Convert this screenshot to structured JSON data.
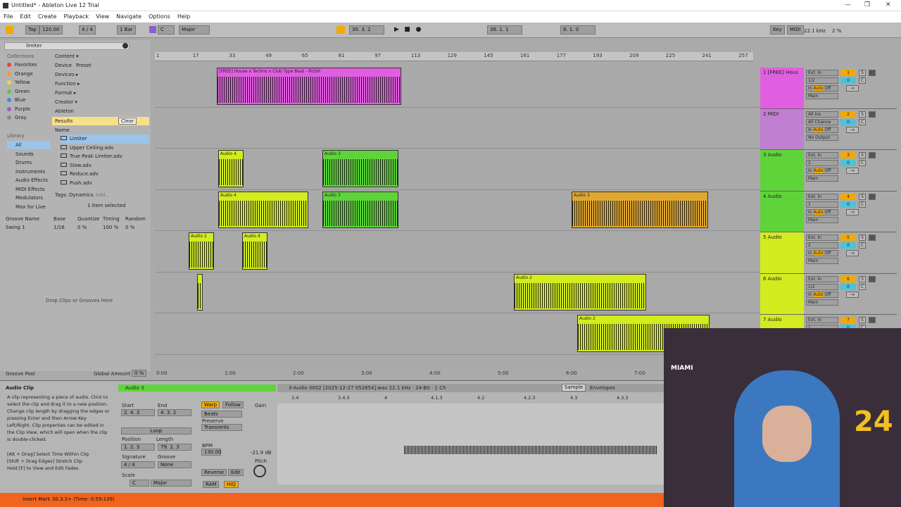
{
  "window": {
    "title": "Untitled* - Ableton Live 12 Trial",
    "min": "—",
    "max": "❐",
    "close": "✕"
  },
  "menu": [
    "File",
    "Edit",
    "Create",
    "Playback",
    "View",
    "Navigate",
    "Options",
    "Help"
  ],
  "control_bar": {
    "tap": "Tap",
    "tempo": "120.00",
    "signature": "4 / 4",
    "quantize": "1 Bar",
    "key": "C",
    "scale": "Major",
    "position": "30. 3. 2",
    "loop_start": "38. 1. 1",
    "loop_length": "8. 1. 0",
    "key_label": "Key",
    "midi_label": "MIDI",
    "sample_rate": "22.1 kHz",
    "cpu": "2 %"
  },
  "browser": {
    "search_value": "limiter",
    "collections_header": "Collections",
    "collections": [
      {
        "label": "Favorites",
        "color": "#e8453c"
      },
      {
        "label": "Orange",
        "color": "#f39c2a"
      },
      {
        "label": "Yellow",
        "color": "#f2d53c"
      },
      {
        "label": "Green",
        "color": "#5ec54a"
      },
      {
        "label": "Blue",
        "color": "#3c8be8"
      },
      {
        "label": "Purple",
        "color": "#9b59d0"
      },
      {
        "label": "Gray",
        "color": "#8a8a8a"
      }
    ],
    "library_header": "Library",
    "library": [
      "All",
      "Sounds",
      "Drums",
      "Instruments",
      "Audio Effects",
      "MIDI Effects",
      "Modulators",
      "Max for Live"
    ],
    "filters": [
      "Content ▾",
      "Device",
      "Preset",
      "Devices ▸",
      "Function ▸",
      "Format ▸",
      "Creator ▾",
      "Ableton"
    ],
    "results_label": "Results",
    "clear": "Clear",
    "name_header": "Name",
    "results": [
      "Limiter",
      "Upper Ceiling.adv",
      "True Peak Limiter.adv",
      "Slow.adv",
      "Reduce.adv",
      "Push.adv"
    ],
    "tags_label": "Tags:",
    "tags_value": "Dynamics",
    "tags_add": "Add...",
    "selected_text": "1 item selected"
  },
  "groove": {
    "headers": [
      "Groove Name",
      "Base",
      "Quantize",
      "Timing",
      "Random"
    ],
    "row": [
      "Swing 1",
      "1/16",
      "0 %",
      "100 %",
      "0 %"
    ],
    "drop_text": "Drop Clips or Grooves Here",
    "pool": "Groove Pool",
    "global_amount": "Global Amount",
    "global_value": "0 %"
  },
  "ruler": [
    "1",
    "17",
    "33",
    "49",
    "65",
    "81",
    "97",
    "113",
    "129",
    "145",
    "161",
    "177",
    "193",
    "209",
    "225",
    "241",
    "257"
  ],
  "time_ticks": [
    "0:00",
    "1:00",
    "2:00",
    "3:00",
    "4:00",
    "5:00",
    "6:00",
    "7:00"
  ],
  "clips": {
    "house": "[FREE] House x Techno x Club Type Beat - RUSH",
    "audio3": "Audio 3",
    "audio4": "Audio 4",
    "audio2": "Audio 2"
  },
  "tracks": [
    {
      "name": "1 [FREE] Hous",
      "color": "#e05fe0",
      "input": "Ext. In",
      "ch": "1/2",
      "num": "1"
    },
    {
      "name": "2 MIDI",
      "color": "#c07fd0",
      "input": "All Ins",
      "ch": "All Channe",
      "num": "2",
      "out": "No Output"
    },
    {
      "name": "3 Audio",
      "color": "#5fd43a",
      "input": "Ext. In",
      "ch": "1",
      "num": "3"
    },
    {
      "name": "4 Audio",
      "color": "#5fd43a",
      "input": "Ext. In",
      "ch": "1",
      "num": "4"
    },
    {
      "name": "5 Audio",
      "color": "#d2ec1f",
      "input": "Ext. In",
      "ch": "2",
      "num": "5"
    },
    {
      "name": "6 Audio",
      "color": "#d2ec1f",
      "input": "Ext. In",
      "ch": "1/2",
      "num": "6"
    },
    {
      "name": "7 Audio",
      "color": "#d2ec1f",
      "input": "Ext. In",
      "ch": "1",
      "num": "7"
    }
  ],
  "track_labels": {
    "in": "In",
    "auto": "Auto",
    "off": "Off",
    "main": "Main",
    "s": "S",
    "c": "C",
    "inf": "-∞",
    "zero": "0",
    "set": "Set"
  },
  "info": {
    "title": "Audio Clip",
    "body": "A clip representing a piece of audio. Click to select the clip and drag it to a new position. Change clip length by dragging the edges or pressing Enter and then Arrow Key Left/Right. Clip properties can be edited in the Clip View, which will open when the clip is double-clicked.",
    "tips": [
      "[Alt + Drag] Select Time Within Clip",
      "[Shift + Drag Edges] Stretch Clip",
      "Hold [F] to View and Edit Fades"
    ]
  },
  "clipview": {
    "name": "Audio 3",
    "file": "3-Audio 0002 [2025-12-27 052854].wav  22.1 kHz · 24-Bit · 1 Ch",
    "start": "Start",
    "end": "End",
    "start_val": "2. 4. 3",
    "end_val": "4. 3. 2",
    "loop": "Loop",
    "position": "Position",
    "length": "Length",
    "pos_val": "1. 2. 3",
    "len_val": "79. 2. 3",
    "signature": "Signature",
    "sig_val": "4 / 4",
    "groove": "Groove",
    "groove_val": "None",
    "scale": "Scale",
    "scale_key": "C",
    "scale_mode": "Major",
    "warp": "Warp",
    "follow": "Follow",
    "beats": "Beats",
    "preserve": "Preserve",
    "transients": "Transients",
    "bpm": "BPM",
    "bpm_val": "130.00",
    "gain": "Gain",
    "gain_val": "-21.9 dB",
    "pitch": "Pitch",
    "reverse": "Reverse",
    "edit": "Edit",
    "ram": "RAM",
    "hiq": "HiQ",
    "sample_tab": "Sample",
    "envelopes_tab": "Envelopes",
    "ruler": [
      "3.4",
      "3.4.3",
      "4",
      "4.1.3",
      "4.2",
      "4.2.3",
      "4.3",
      "4.3.3"
    ]
  },
  "status": "Insert Mark 30.3.2+ (Time: 0:59:139)",
  "webcam": {
    "text": "MIAMI",
    "number": "24"
  }
}
